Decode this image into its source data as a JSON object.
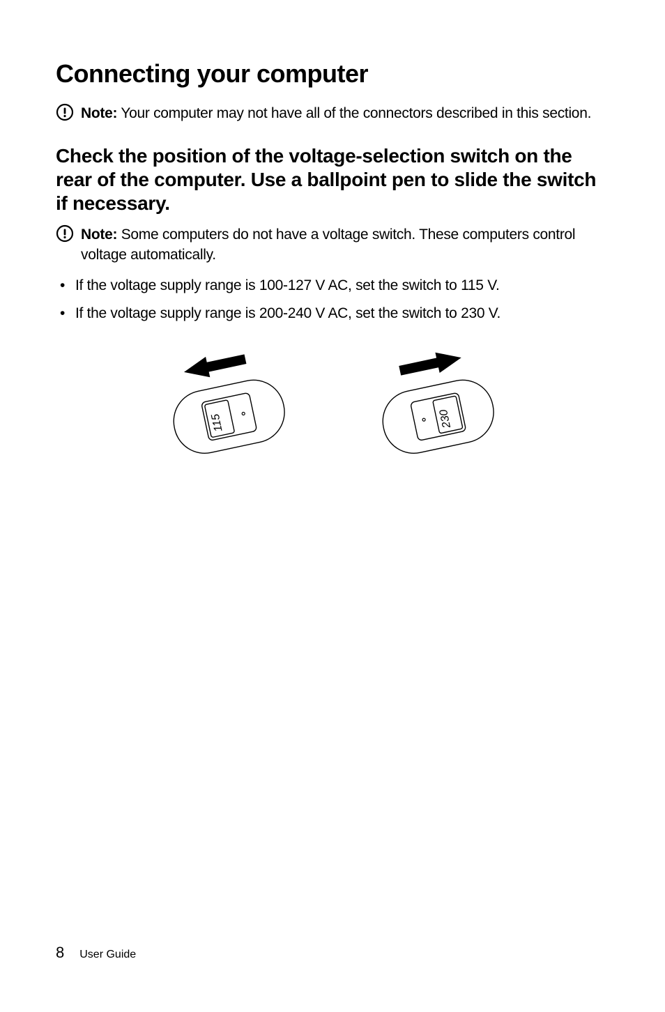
{
  "heading": "Connecting your computer",
  "note1": {
    "label": "Note:",
    "text": " Your computer may not have all of the connectors described in this section."
  },
  "subheading": "Check the position of the voltage-selection switch on the rear of the computer. Use a ballpoint pen to slide the switch if necessary.",
  "note2": {
    "label": "Note:",
    "text": " Some computers do not have a voltage switch. These computers control voltage automatically."
  },
  "bullets": [
    "If the voltage supply range is 100-127 V AC, set the switch to 115 V.",
    "If the voltage supply range is 200-240 V AC, set the switch to 230 V."
  ],
  "switch_labels": {
    "left": "115",
    "right": "230"
  },
  "footer": {
    "page": "8",
    "label": "User Guide"
  }
}
